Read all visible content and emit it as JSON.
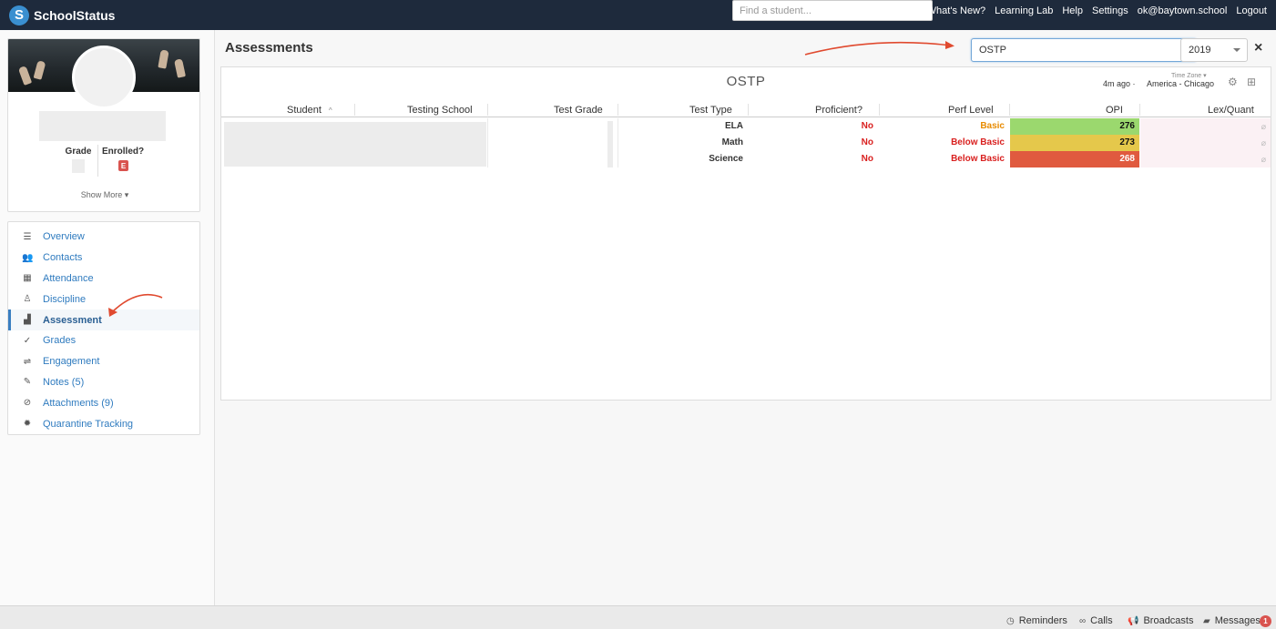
{
  "app": {
    "name": "SchoolStatus",
    "logo_letter": "S"
  },
  "topnav": {
    "search_placeholder": "Find a student...",
    "links": [
      "What's New?",
      "Learning Lab",
      "Help",
      "Settings",
      "ok@baytown.school",
      "Logout"
    ]
  },
  "profile": {
    "grade_label": "Grade",
    "enrolled_label": "Enrolled?",
    "enrolled_badge": "E",
    "show_more": "Show More ▾"
  },
  "sidebar": {
    "items": [
      {
        "label": "Overview",
        "icon": "list-icon",
        "glyph": "☰"
      },
      {
        "label": "Contacts",
        "icon": "users-icon",
        "glyph": "👥"
      },
      {
        "label": "Attendance",
        "icon": "calendar-icon",
        "glyph": "▦"
      },
      {
        "label": "Discipline",
        "icon": "alert-icon",
        "glyph": "♙"
      },
      {
        "label": "Assessment",
        "icon": "chart-icon",
        "glyph": "▟",
        "active": true
      },
      {
        "label": "Grades",
        "icon": "check-icon",
        "glyph": "✓"
      },
      {
        "label": "Engagement",
        "icon": "engagement-icon",
        "glyph": "⇌"
      },
      {
        "label": "Notes (5)",
        "icon": "pencil-icon",
        "glyph": "✎"
      },
      {
        "label": "Attachments (9)",
        "icon": "paperclip-icon",
        "glyph": "⊘"
      },
      {
        "label": "Quarantine Tracking",
        "icon": "virus-icon",
        "glyph": "✹"
      }
    ]
  },
  "main": {
    "title": "Assessments",
    "assessment_select": "OSTP",
    "year_select": "2019",
    "close": "×"
  },
  "panel": {
    "title": "OSTP",
    "refresh": "4m ago  ·",
    "timezone_label": "Time Zone ▾",
    "timezone_value": "America - Chicago",
    "columns": [
      "Student",
      "Testing School",
      "Test Grade",
      "Test Type",
      "Proficient?",
      "Perf Level",
      "OPI",
      "Lex/Quant"
    ],
    "student_sort": "^",
    "rows": [
      {
        "test_type": "ELA",
        "proficient": "No",
        "perf_level": "Basic",
        "perf_class": "basic",
        "opi": "276",
        "opi_color": "#9bd86e",
        "lex": "⌀"
      },
      {
        "test_type": "Math",
        "proficient": "No",
        "perf_level": "Below Basic",
        "perf_class": "below",
        "opi": "273",
        "opi_color": "#e5c84b",
        "lex": "⌀"
      },
      {
        "test_type": "Science",
        "proficient": "No",
        "perf_level": "Below Basic",
        "perf_class": "below",
        "opi": "268",
        "opi_color": "#e05a3f",
        "opi_text": "#ffffff",
        "lex": "⌀"
      }
    ]
  },
  "footer": {
    "items": [
      {
        "label": "Reminders",
        "icon": "clock-icon",
        "glyph": "◷"
      },
      {
        "label": "Calls",
        "icon": "voicemail-icon",
        "glyph": "∞"
      },
      {
        "label": "Broadcasts",
        "icon": "megaphone-icon",
        "glyph": "📢"
      },
      {
        "label": "Messages",
        "icon": "messages-icon",
        "glyph": "▰"
      }
    ],
    "messages_count": "1"
  }
}
